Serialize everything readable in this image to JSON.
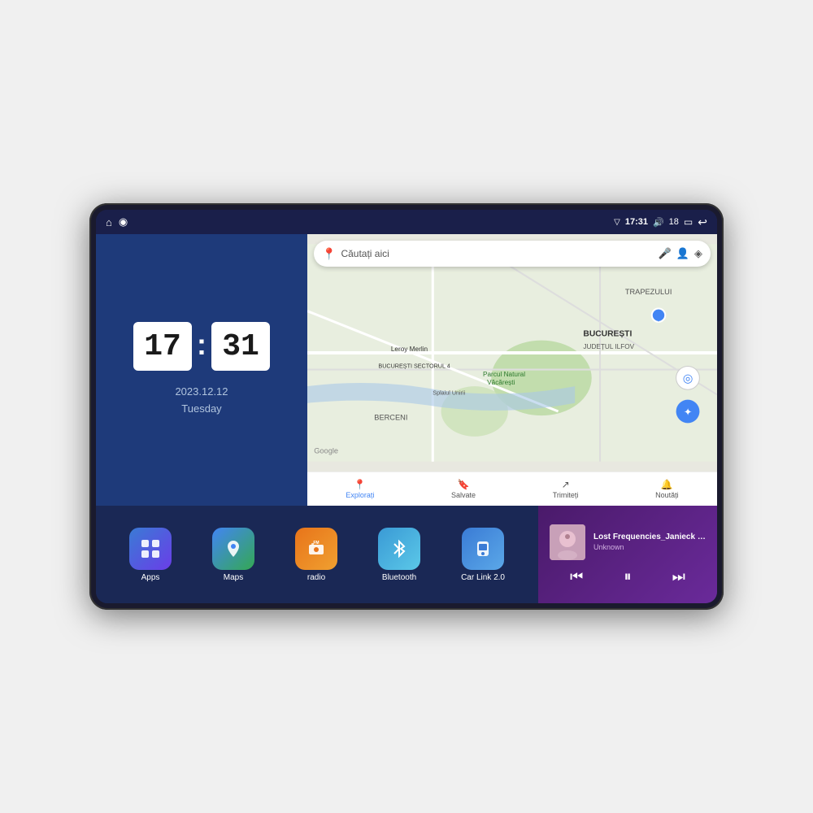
{
  "device": {
    "status_bar": {
      "nav_home": "⌂",
      "nav_maps": "◉",
      "signal": "▽",
      "time": "17:31",
      "volume": "🔊",
      "battery_level": "18",
      "battery_icon": "🔋",
      "back": "↩"
    },
    "clock": {
      "hour": "17",
      "minute": "31",
      "date": "2023.12.12",
      "day": "Tuesday"
    },
    "map": {
      "search_placeholder": "Căutați aici",
      "tabs": [
        {
          "icon": "📍",
          "label": "Explorați"
        },
        {
          "icon": "🔖",
          "label": "Salvate"
        },
        {
          "icon": "↗",
          "label": "Trimiteți"
        },
        {
          "icon": "🔔",
          "label": "Noutăți"
        }
      ],
      "location_label": "BUCUREȘTI",
      "sublocation_label": "JUDEȚUL ILFOV",
      "area1": "BERCENI",
      "area2": "TRAPEZULUI",
      "street": "Splaiul Unirii",
      "park": "Parcul Natural Văcărești",
      "store": "Leroy Merlin",
      "sector": "BUCUREȘTI SECTORUL 4",
      "brand": "Google"
    },
    "apps": [
      {
        "id": "apps",
        "label": "Apps",
        "icon": "⊞",
        "class": "app-icon-apps"
      },
      {
        "id": "maps",
        "label": "Maps",
        "icon": "📍",
        "class": "app-icon-maps"
      },
      {
        "id": "radio",
        "label": "radio",
        "icon": "📻",
        "class": "app-icon-radio"
      },
      {
        "id": "bluetooth",
        "label": "Bluetooth",
        "icon": "⬡",
        "class": "app-icon-bluetooth"
      },
      {
        "id": "carlink",
        "label": "Car Link 2.0",
        "icon": "📱",
        "class": "app-icon-carlink"
      }
    ],
    "music": {
      "title": "Lost Frequencies_Janieck Devy-...",
      "artist": "Unknown",
      "btn_prev": "⏮",
      "btn_play": "⏸",
      "btn_next": "⏭"
    }
  }
}
